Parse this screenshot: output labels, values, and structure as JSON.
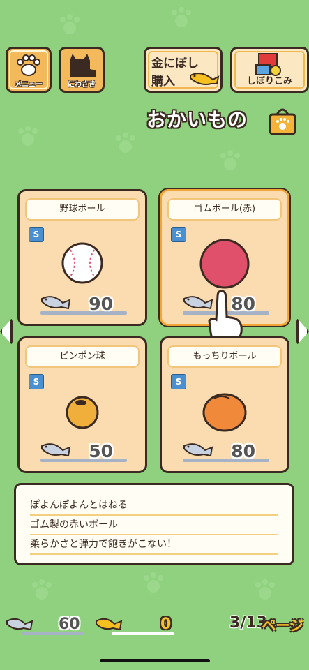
{
  "nav": {
    "menu_label": "メニュー",
    "garden_label": "にわさき",
    "niboshi_line1": "金にぼし",
    "niboshi_line2": "購入",
    "shibori_label": "しぼりこみ"
  },
  "page_title": "おかいもの",
  "items": [
    {
      "name": "野球ボール",
      "rank": "S",
      "price": "90",
      "icon": "baseball-icon"
    },
    {
      "name": "ゴムボール(赤)",
      "rank": "S",
      "price": "80",
      "icon": "red-rubber-ball-icon"
    },
    {
      "name": "ピンポン球",
      "rank": "S",
      "price": "50",
      "icon": "ping-pong-ball-icon"
    },
    {
      "name": "もっちりボール",
      "rank": "S",
      "price": "80",
      "icon": "mochi-ball-icon"
    }
  ],
  "selected_item": "ゴムボール(赤)",
  "description": [
    "ぽよんぽよんとはねる",
    "ゴム製の赤いボール",
    "柔らかさと弾力で飽きがこない！"
  ],
  "currency": {
    "silver_niboshi": "60",
    "gold_niboshi": "0"
  },
  "pagination": {
    "current": "3/13",
    "word": "ページ"
  },
  "colors": {
    "background": "#8fd17f",
    "card": "#fbdcb0",
    "selected_border": "#f0a637",
    "outline": "#3a2a22"
  }
}
